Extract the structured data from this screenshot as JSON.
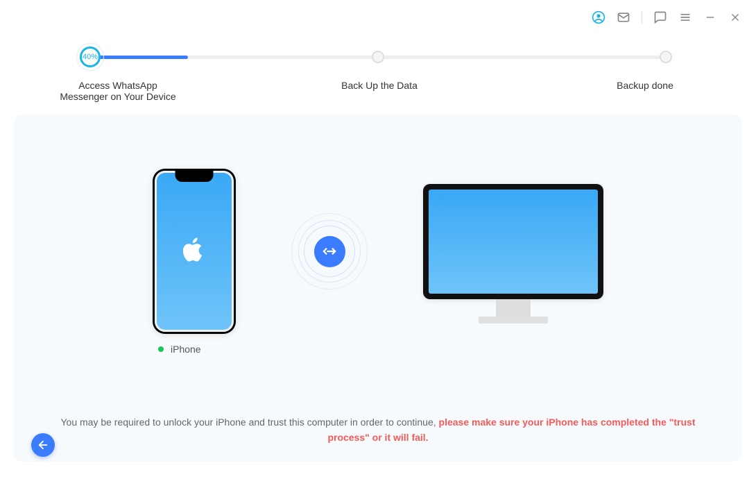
{
  "progress": {
    "percent_label": "40%",
    "fill_width_pct": "17%",
    "steps": [
      {
        "label": "Access WhatsApp Messenger on Your Device"
      },
      {
        "label": "Back Up the Data"
      },
      {
        "label": "Backup done"
      }
    ]
  },
  "device": {
    "name": "iPhone"
  },
  "message": {
    "lead": "You may be required to unlock your iPhone and trust this computer in order to continue, ",
    "warn": "please make sure your iPhone has completed the \"trust process\" or it will fail."
  }
}
